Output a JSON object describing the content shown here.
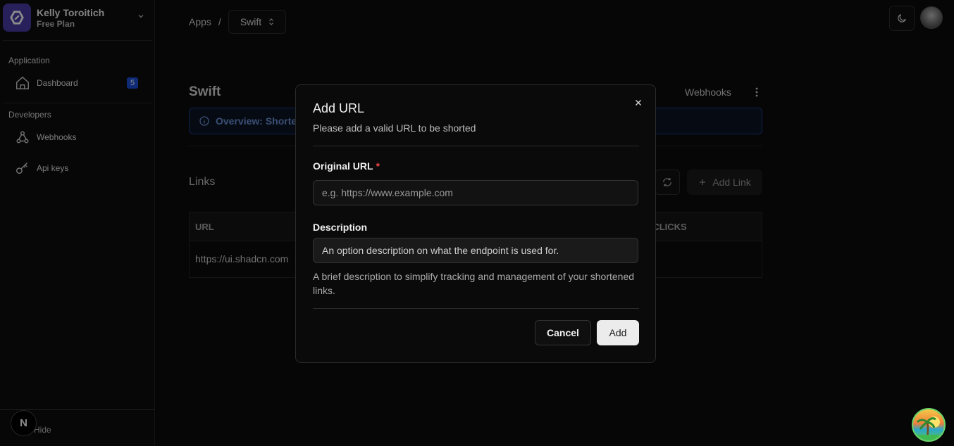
{
  "sidebar": {
    "org_name": "Kelly Toroitich",
    "org_plan": "Free Plan",
    "groups": {
      "application": "Application",
      "developers": "Developers"
    },
    "items": [
      {
        "label": "Dashboard",
        "icon": "home-icon",
        "badge": "5"
      },
      {
        "label": "Webhooks",
        "icon": "webhook-icon"
      },
      {
        "label": "Api keys",
        "icon": "key-icon"
      }
    ],
    "hide_label": "Hide",
    "next_badge_letter": "N"
  },
  "header": {
    "breadcrumb_root": "Apps",
    "breadcrumb_sep": "/",
    "app_select": "Swift"
  },
  "main": {
    "title": "Swift",
    "webhooks_link": "Webhooks",
    "alert_text": "Overview:  Shorte",
    "links_title": "Links",
    "add_link_label": "Add Link",
    "table": {
      "col_url": "URL",
      "col_clicks": "L CLICKS",
      "rows": [
        {
          "url": "https://ui.shadcn.com"
        }
      ]
    }
  },
  "dialog": {
    "title": "Add URL",
    "description": "Please add a valid URL to be shorted",
    "original_url_label": "Original URL",
    "required_mark": "*",
    "original_url_placeholder": "e.g. https://www.example.com",
    "description_label": "Description",
    "description_value": "An option description on what the endpoint is used for.",
    "help_text": "A brief description to simplify tracking and management of your shortened links.",
    "cancel_label": "Cancel",
    "add_label": "Add"
  },
  "colors": {
    "accent_blue": "#1d4ed8",
    "org_logo": "#4a3ba6",
    "required": "#ef4444"
  }
}
